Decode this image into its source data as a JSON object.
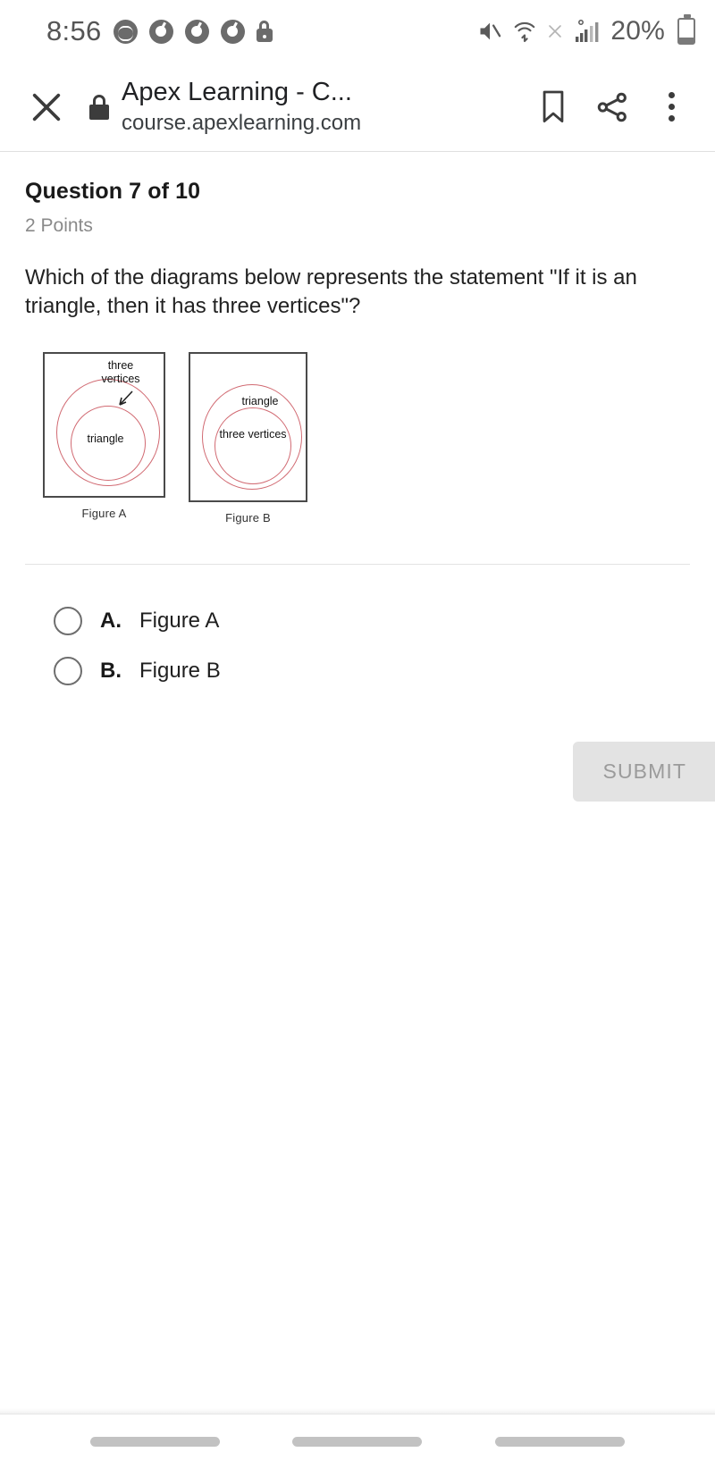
{
  "status_bar": {
    "time": "8:56",
    "battery_percent": "20%",
    "icons": [
      "spotify-icon",
      "chrome-icon",
      "chrome-icon",
      "chrome-icon",
      "lock-icon",
      "mute-icon",
      "wifi-icon",
      "nfc-off-icon",
      "signal-icon",
      "battery-icon"
    ]
  },
  "browser_bar": {
    "close_icon": "close-icon",
    "security_icon": "lock-icon",
    "title": "Apex Learning - C...",
    "url": "course.apexlearning.com",
    "bookmark_icon": "bookmark-icon",
    "share_icon": "share-icon",
    "menu_icon": "more-vertical-icon"
  },
  "question": {
    "heading": "Question 7 of 10",
    "points": "2 Points",
    "prompt": "Which of the diagrams below represents the statement \"If it is an triangle, then it has three vertices\"?"
  },
  "figures": [
    {
      "caption": "Figure A",
      "outer_label": "three vertices",
      "inner_label": "triangle",
      "has_arrow": true
    },
    {
      "caption": "Figure B",
      "outer_label": "triangle",
      "inner_label": "three vertices",
      "has_arrow": false
    }
  ],
  "options": [
    {
      "letter": "A.",
      "label": "Figure A",
      "selected": false
    },
    {
      "letter": "B.",
      "label": "Figure B",
      "selected": false
    }
  ],
  "submit": {
    "label": "SUBMIT",
    "enabled": false
  },
  "nav_bar": {
    "pills": 3
  },
  "colors": {
    "diagram_circle": "#d16a72",
    "diagram_border": "#4a4a4a",
    "text_primary": "#1f1f1f",
    "text_muted": "#8a8a8a",
    "submit_bg": "#e3e3e3",
    "submit_text": "#9b9b9b"
  }
}
